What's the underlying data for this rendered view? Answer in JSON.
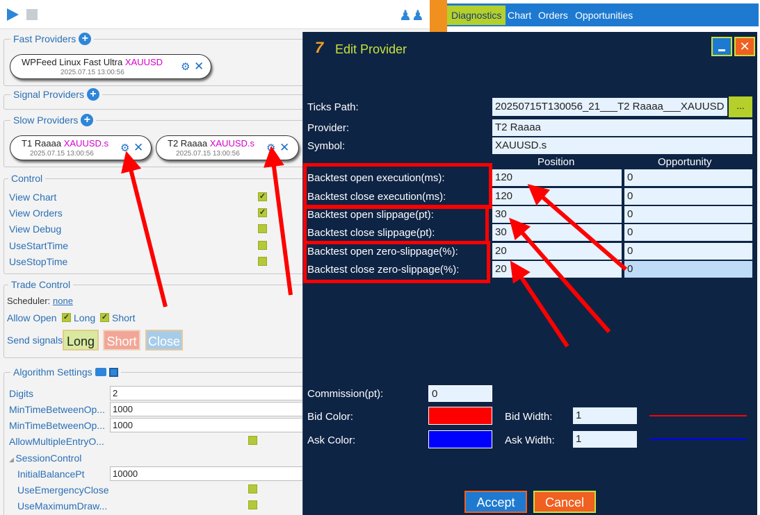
{
  "left": {
    "fast_providers": {
      "title": "Fast Providers",
      "provider": {
        "name": "WPFeed Linux  Fast Ultra",
        "symbol": "XAUUSD",
        "time": "2025.07.15 13:00:56"
      }
    },
    "signal_providers": {
      "title": "Signal Providers"
    },
    "slow_providers": {
      "title": "Slow Providers",
      "items": [
        {
          "name": "T1 Raaaa",
          "symbol": "XAUUSD.s",
          "time": "2025.07.15 13:00:56"
        },
        {
          "name": "T2 Raaaa",
          "symbol": "XAUUSD.s",
          "time": "2025.07.15 13:00:56"
        }
      ]
    },
    "control": {
      "title": "Control",
      "items": [
        {
          "label": "View Chart",
          "checked": true
        },
        {
          "label": "View Orders",
          "checked": true
        },
        {
          "label": "View Debug",
          "checked": false
        },
        {
          "label": "UseStartTime",
          "checked": false
        },
        {
          "label": "UseStopTime",
          "checked": false
        }
      ]
    },
    "trade_control": {
      "title": "Trade Control",
      "scheduler_label": "Scheduler:",
      "scheduler_value": "none",
      "allow_open_label": "Allow Open",
      "long_label": "Long",
      "short_label": "Short",
      "send_signals_label": "Send signals:",
      "btn_long": "Long",
      "btn_short": "Short",
      "btn_close": "Close"
    },
    "algorithm": {
      "title": "Algorithm Settings",
      "rows": [
        {
          "label": "Digits",
          "value": "2"
        },
        {
          "label": "MinTimeBetweenOp...",
          "value": "1000"
        },
        {
          "label": "MinTimeBetweenOp...",
          "value": "1000"
        },
        {
          "label": "AllowMultipleEntryO...",
          "value": ""
        },
        {
          "label": "SessionControl",
          "value": ""
        },
        {
          "label": "InitialBalancePt",
          "value": "10000"
        },
        {
          "label": "UseEmergencyClose",
          "value": ""
        },
        {
          "label": "UseMaximumDraw...",
          "value": ""
        }
      ]
    }
  },
  "tabs": [
    "Diagnostics",
    "Chart",
    "Orders",
    "Opportunities"
  ],
  "dialog": {
    "title": "Edit Provider",
    "ticks_path_label": "Ticks Path:",
    "ticks_path_value": "20250715T130056_21___T2 Raaaa___XAUUSD",
    "browse_label": "...",
    "provider_label": "Provider:",
    "provider_value": "T2 Raaaa",
    "symbol_label": "Symbol:",
    "symbol_value": "XAUUSD.s",
    "col_position": "Position",
    "col_opportunity": "Opportunity",
    "rows": [
      {
        "label": "Backtest open execution(ms):",
        "position": "120",
        "opportunity": "0"
      },
      {
        "label": "Backtest close execution(ms):",
        "position": "120",
        "opportunity": "0"
      },
      {
        "label": "Backtest open slippage(pt):",
        "position": "30",
        "opportunity": "0"
      },
      {
        "label": "Backtest close slippage(pt):",
        "position": "30",
        "opportunity": "0"
      },
      {
        "label": "Backtest open zero-slippage(%):",
        "position": "20",
        "opportunity": "0"
      },
      {
        "label": "Backtest close zero-slippage(%):",
        "position": "20",
        "opportunity": "0"
      }
    ],
    "commission_label": "Commission(pt):",
    "commission_value": "0",
    "bid_color_label": "Bid Color:",
    "bid_color": "#ff0000",
    "bid_width_label": "Bid Width:",
    "bid_width_value": "1",
    "ask_color_label": "Ask Color:",
    "ask_color": "#0000ff",
    "ask_width_label": "Ask Width:",
    "ask_width_value": "1",
    "accept_label": "Accept",
    "cancel_label": "Cancel"
  },
  "colors": {
    "accent_blue": "#1e7ad1",
    "dialog_bg": "#0e2445",
    "annotation_red": "#ff0000",
    "check_green": "#b5c838"
  }
}
